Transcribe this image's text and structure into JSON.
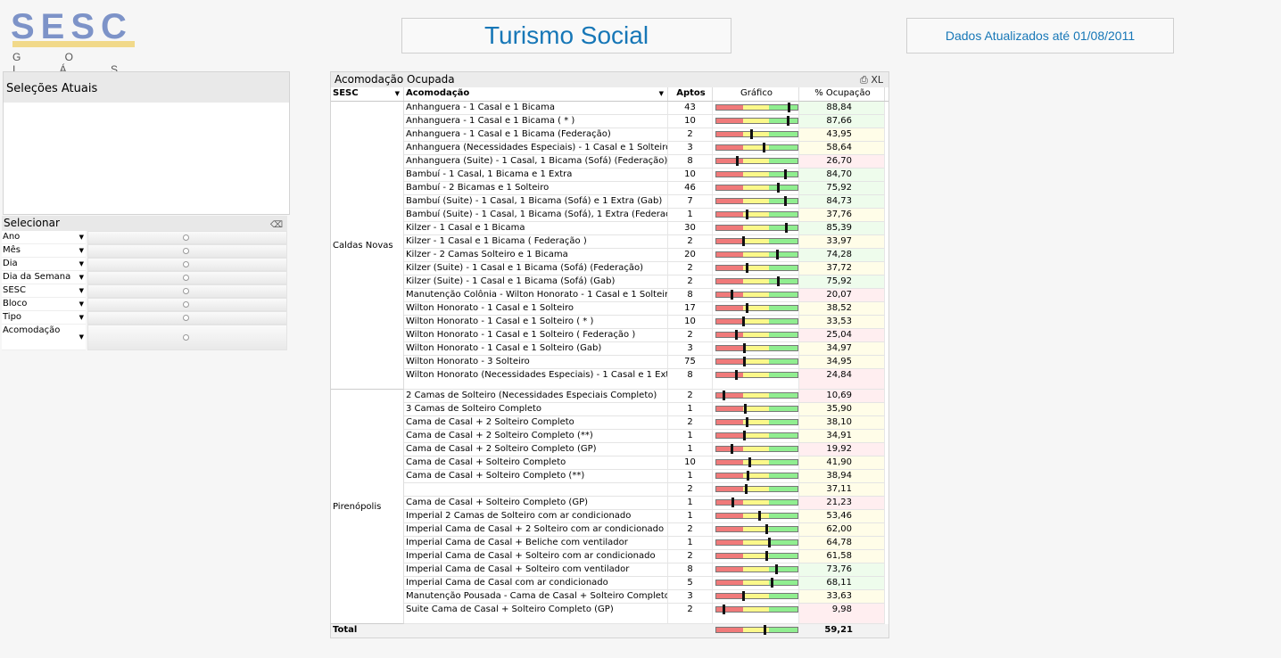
{
  "logo": {
    "name": "SESC",
    "region": "G O I Á S"
  },
  "title": "Turismo Social",
  "updated": "Dados Atualizados até 01/08/2011",
  "current_selections": {
    "title": "Seleções Atuais"
  },
  "select_panel": {
    "title": "Selecionar",
    "filters": [
      "Ano",
      "Mês",
      "Dia",
      "Dia da Semana",
      "SESC",
      "Bloco",
      "Tipo",
      "Acomodação"
    ]
  },
  "table": {
    "title": "Acomodação Ocupada",
    "icons": {
      "print": "print-icon",
      "export": "XL"
    },
    "columns": {
      "sesc": "SESC",
      "acomodacao": "Acomodação",
      "aptos": "Aptos",
      "grafico": "Gráfico",
      "ocupacao": "% Ocupação"
    },
    "colors": {
      "red": "#f07a7a",
      "yellow": "#fbf88a",
      "green": "#90ee90",
      "low_bg": "#ffeef0",
      "mid_bg": "#fffde8",
      "high_bg": "#eefcec"
    },
    "groups": [
      {
        "sesc": "Caldas Novas",
        "rows": [
          {
            "acomodacao": "Anhanguera - 1 Casal e 1 Bicama",
            "aptos": "43",
            "pct": "88,84",
            "value": 88.84
          },
          {
            "acomodacao": "Anhanguera - 1 Casal e 1 Bicama ( * )",
            "aptos": "10",
            "pct": "87,66",
            "value": 87.66
          },
          {
            "acomodacao": "Anhanguera - 1 Casal e 1 Bicama (Federação)",
            "aptos": "2",
            "pct": "43,95",
            "value": 43.95
          },
          {
            "acomodacao": "Anhanguera (Necessidades Especiais) - 1 Casal e 1 Solteiro",
            "aptos": "3",
            "pct": "58,64",
            "value": 58.64
          },
          {
            "acomodacao": "Anhanguera (Suite) - 1 Casal, 1 Bicama (Sofá) (Federação)",
            "aptos": "8",
            "pct": "26,70",
            "value": 26.7
          },
          {
            "acomodacao": "Bambuí - 1 Casal, 1 Bicama e 1 Extra",
            "aptos": "10",
            "pct": "84,70",
            "value": 84.7
          },
          {
            "acomodacao": "Bambuí - 2 Bicamas e 1 Solteiro",
            "aptos": "46",
            "pct": "75,92",
            "value": 75.92
          },
          {
            "acomodacao": "Bambuí (Suite) - 1 Casal, 1 Bicama (Sofá) e 1 Extra (Gab)",
            "aptos": "7",
            "pct": "84,73",
            "value": 84.73
          },
          {
            "acomodacao": "Bambuí (Suite) - 1 Casal, 1 Bicama (Sofá), 1 Extra (Federaç)",
            "aptos": "1",
            "pct": "37,76",
            "value": 37.76
          },
          {
            "acomodacao": "Kilzer - 1 Casal e 1 Bicama",
            "aptos": "30",
            "pct": "85,39",
            "value": 85.39
          },
          {
            "acomodacao": "Kilzer - 1 Casal e 1 Bicama ( Federação )",
            "aptos": "2",
            "pct": "33,97",
            "value": 33.97
          },
          {
            "acomodacao": "Kilzer - 2 Camas Solteiro e 1 Bicama",
            "aptos": "20",
            "pct": "74,28",
            "value": 74.28
          },
          {
            "acomodacao": "Kilzer (Suite) - 1 Casal e 1 Bicama (Sofá) (Federação)",
            "aptos": "2",
            "pct": "37,72",
            "value": 37.72
          },
          {
            "acomodacao": "Kilzer (Suite) - 1 Casal e 1 Bicama (Sofá) (Gab)",
            "aptos": "2",
            "pct": "75,92",
            "value": 75.92
          },
          {
            "acomodacao": "Manutenção Colônia - Wilton Honorato - 1 Casal e 1 Solteiro",
            "aptos": "8",
            "pct": "20,07",
            "value": 20.07
          },
          {
            "acomodacao": "Wilton Honorato - 1 Casal e 1 Solteiro",
            "aptos": "17",
            "pct": "38,52",
            "value": 38.52
          },
          {
            "acomodacao": "Wilton Honorato - 1 Casal e 1 Solteiro ( * )",
            "aptos": "10",
            "pct": "33,53",
            "value": 33.53
          },
          {
            "acomodacao": "Wilton Honorato - 1 Casal e 1 Solteiro ( Federação )",
            "aptos": "2",
            "pct": "25,04",
            "value": 25.04
          },
          {
            "acomodacao": "Wilton Honorato - 1 Casal e 1 Solteiro (Gab)",
            "aptos": "3",
            "pct": "34,97",
            "value": 34.97
          },
          {
            "acomodacao": "Wilton Honorato - 3 Solteiro",
            "aptos": "75",
            "pct": "34,95",
            "value": 34.95
          },
          {
            "acomodacao": "Wilton Honorato (Necessidades Especiais) - 1 Casal e 1 Extra",
            "aptos": "8",
            "pct": "24,84",
            "value": 24.84
          }
        ]
      },
      {
        "sesc": "Pirenópolis",
        "rows": [
          {
            "acomodacao": "2 Camas de Solteiro (Necessidades Especiais Completo)",
            "aptos": "2",
            "pct": "10,69",
            "value": 10.69
          },
          {
            "acomodacao": "3 Camas de Solteiro Completo",
            "aptos": "1",
            "pct": "35,90",
            "value": 35.9
          },
          {
            "acomodacao": "Cama de Casal + 2 Solteiro Completo",
            "aptos": "2",
            "pct": "38,10",
            "value": 38.1
          },
          {
            "acomodacao": "Cama de Casal + 2 Solteiro Completo (**)",
            "aptos": "1",
            "pct": "34,91",
            "value": 34.91
          },
          {
            "acomodacao": "Cama de Casal + 2 Solteiro Completo (GP)",
            "aptos": "1",
            "pct": "19,92",
            "value": 19.92
          },
          {
            "acomodacao": "Cama de Casal + Solteiro Completo",
            "aptos": "10",
            "pct": "41,90",
            "value": 41.9
          },
          {
            "acomodacao": "Cama de Casal + Solteiro Completo (**)",
            "aptos": "1",
            "pct": "38,94",
            "value": 38.94
          },
          {
            "acomodacao": "",
            "aptos": "2",
            "pct": "37,11",
            "value": 37.11
          },
          {
            "acomodacao": "Cama de Casal + Solteiro Completo (GP)",
            "aptos": "1",
            "pct": "21,23",
            "value": 21.23
          },
          {
            "acomodacao": "Imperial 2 Camas de Solteiro com ar condicionado",
            "aptos": "1",
            "pct": "53,46",
            "value": 53.46
          },
          {
            "acomodacao": "Imperial Cama de Casal + 2 Solteiro com ar condicionado",
            "aptos": "2",
            "pct": "62,00",
            "value": 62.0
          },
          {
            "acomodacao": "Imperial Cama de Casal + Beliche com ventilador",
            "aptos": "1",
            "pct": "64,78",
            "value": 64.78
          },
          {
            "acomodacao": "Imperial Cama de Casal + Solteiro com ar condicionado",
            "aptos": "2",
            "pct": "61,58",
            "value": 61.58
          },
          {
            "acomodacao": "Imperial Cama de Casal + Solteiro com ventilador",
            "aptos": "8",
            "pct": "73,76",
            "value": 73.76
          },
          {
            "acomodacao": "Imperial Cama de Casal com ar condicionado",
            "aptos": "5",
            "pct": "68,11",
            "value": 68.11
          },
          {
            "acomodacao": "Manutenção Pousada - Cama de Casal + Solteiro Completo",
            "aptos": "3",
            "pct": "33,63",
            "value": 33.63
          },
          {
            "acomodacao": "Suite Cama de Casal + Solteiro Completo (GP)",
            "aptos": "2",
            "pct": "9,98",
            "value": 9.98
          }
        ]
      }
    ],
    "total": {
      "label": "Total",
      "pct": "59,21",
      "value": 59.21
    }
  }
}
